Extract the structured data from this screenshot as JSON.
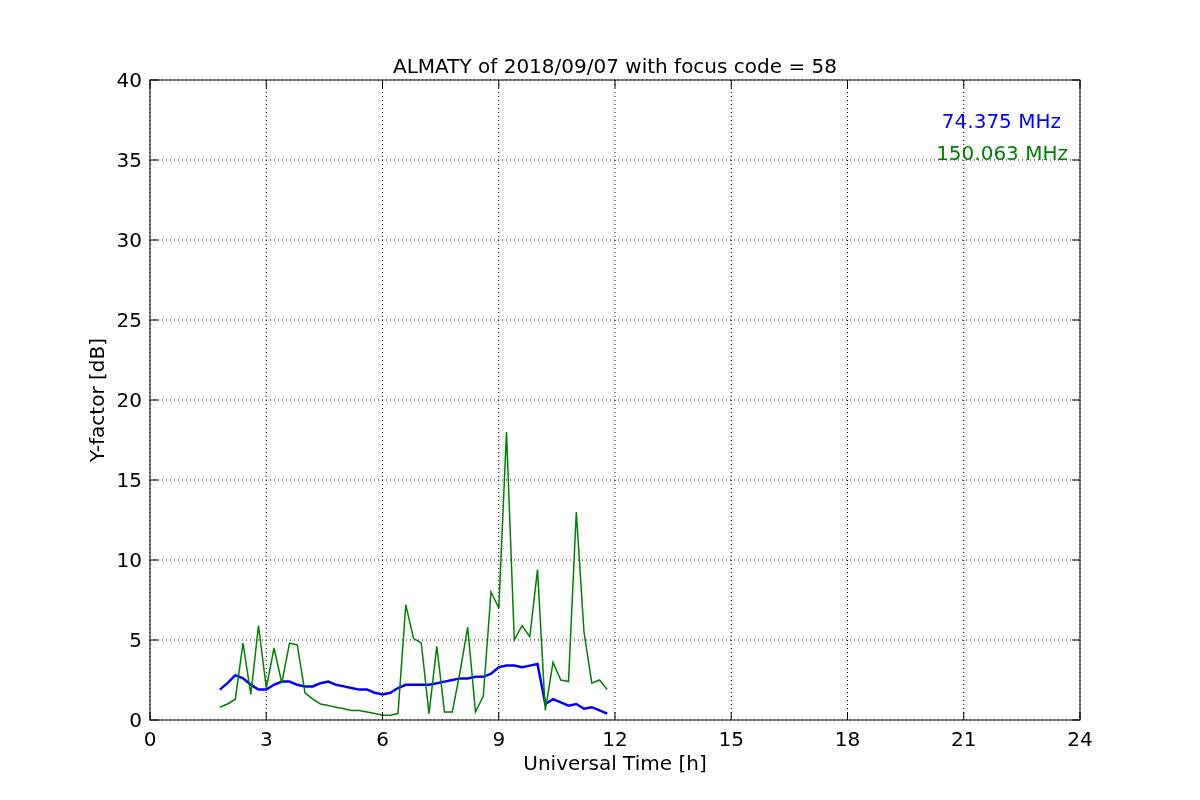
{
  "figure": {
    "chart_data": {
      "type": "line",
      "title": "ALMATY of 2018/09/07 with focus code = 58",
      "xlabel": "Universal Time [h]",
      "ylabel": "Y-factor [dB]",
      "x": [
        1.8,
        2.0,
        2.2,
        2.4,
        2.6,
        2.8,
        3.0,
        3.2,
        3.4,
        3.6,
        3.8,
        4.0,
        4.2,
        4.4,
        4.6,
        4.8,
        5.0,
        5.2,
        5.4,
        5.6,
        5.8,
        6.0,
        6.2,
        6.4,
        6.6,
        6.8,
        7.0,
        7.2,
        7.4,
        7.6,
        7.8,
        8.0,
        8.2,
        8.4,
        8.6,
        8.8,
        9.0,
        9.2,
        9.4,
        9.6,
        9.8,
        10.0,
        10.2,
        10.4,
        10.6,
        10.8,
        11.0,
        11.2,
        11.4,
        11.6,
        11.8
      ],
      "series": [
        {
          "name": "74.375 MHz",
          "color": "#0000ff",
          "values": [
            1.9,
            2.3,
            2.8,
            2.6,
            2.2,
            1.9,
            1.9,
            2.2,
            2.4,
            2.4,
            2.2,
            2.1,
            2.1,
            2.3,
            2.4,
            2.2,
            2.1,
            2.0,
            1.9,
            1.9,
            1.7,
            1.6,
            1.7,
            2.0,
            2.2,
            2.2,
            2.2,
            2.2,
            2.3,
            2.4,
            2.5,
            2.6,
            2.6,
            2.7,
            2.7,
            2.9,
            3.3,
            3.4,
            3.4,
            3.3,
            3.4,
            3.5,
            1.0,
            1.3,
            1.1,
            0.9,
            1.0,
            0.7,
            0.8,
            0.6,
            0.4
          ]
        },
        {
          "name": "150.063 MHz",
          "color": "#008000",
          "values": [
            0.8,
            1.0,
            1.3,
            4.8,
            1.6,
            5.9,
            2.0,
            4.5,
            2.3,
            4.8,
            4.7,
            1.7,
            1.3,
            1.0,
            0.9,
            0.8,
            0.7,
            0.6,
            0.6,
            0.5,
            0.4,
            0.3,
            0.3,
            0.4,
            7.2,
            5.1,
            4.8,
            0.4,
            4.6,
            0.5,
            0.5,
            3.0,
            5.8,
            0.5,
            1.5,
            8.0,
            7.0,
            18.0,
            5.0,
            5.9,
            5.2,
            9.4,
            0.6,
            3.6,
            2.5,
            2.4,
            13.0,
            5.5,
            2.3,
            2.5,
            1.9
          ]
        }
      ],
      "grid": true,
      "xlim": [
        0,
        24
      ],
      "ylim": [
        0,
        40
      ],
      "xticks": [
        0,
        3,
        6,
        9,
        12,
        15,
        18,
        21,
        24
      ],
      "yticks": [
        0,
        5,
        10,
        15,
        20,
        25,
        30,
        35,
        40
      ]
    }
  }
}
